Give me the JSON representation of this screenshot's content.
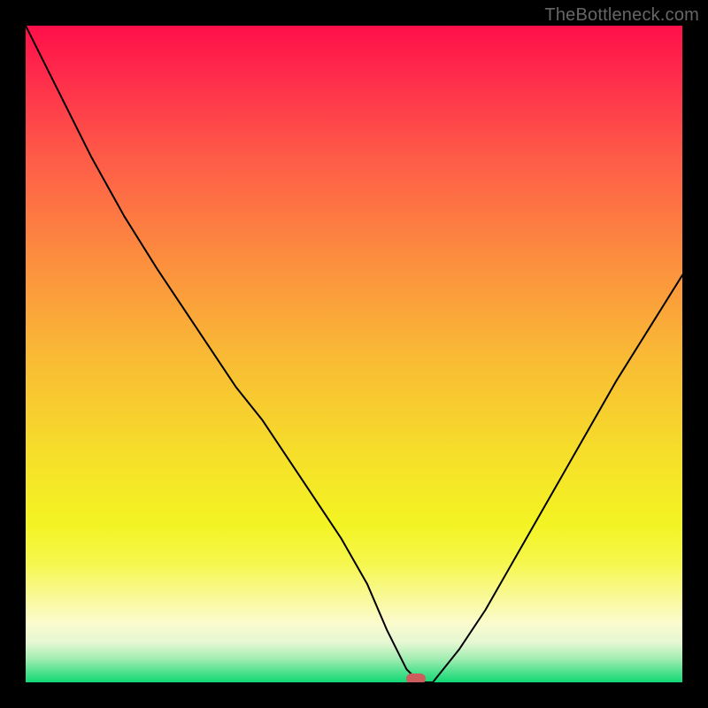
{
  "attribution": "TheBottleneck.com",
  "chart_data": {
    "type": "line",
    "title": "",
    "xlabel": "",
    "ylabel": "",
    "x": [
      0.0,
      0.05,
      0.1,
      0.15,
      0.2,
      0.24,
      0.28,
      0.32,
      0.36,
      0.4,
      0.44,
      0.48,
      0.52,
      0.55,
      0.58,
      0.6,
      0.62,
      0.66,
      0.7,
      0.74,
      0.78,
      0.82,
      0.86,
      0.9,
      0.95,
      1.0
    ],
    "values": [
      1.0,
      0.9,
      0.8,
      0.71,
      0.63,
      0.57,
      0.51,
      0.45,
      0.4,
      0.34,
      0.28,
      0.22,
      0.15,
      0.08,
      0.02,
      0.0,
      0.0,
      0.05,
      0.11,
      0.18,
      0.25,
      0.32,
      0.39,
      0.46,
      0.54,
      0.62
    ],
    "xlim": [
      0,
      1
    ],
    "ylim": [
      0,
      1
    ],
    "marker": {
      "x": 0.595,
      "y": 0.0
    },
    "gradient_stops": [
      {
        "offset": 0.0,
        "color": "#FF0F4A"
      },
      {
        "offset": 0.08,
        "color": "#FF2D4B"
      },
      {
        "offset": 0.2,
        "color": "#FE5B48"
      },
      {
        "offset": 0.35,
        "color": "#FC8C3F"
      },
      {
        "offset": 0.5,
        "color": "#F9B935"
      },
      {
        "offset": 0.65,
        "color": "#F6DE2A"
      },
      {
        "offset": 0.76,
        "color": "#F3F423"
      },
      {
        "offset": 0.82,
        "color": "#F6F74F"
      },
      {
        "offset": 0.87,
        "color": "#F9F998"
      },
      {
        "offset": 0.91,
        "color": "#FBFBCE"
      },
      {
        "offset": 0.94,
        "color": "#E4F7D2"
      },
      {
        "offset": 0.965,
        "color": "#9FEDB0"
      },
      {
        "offset": 0.985,
        "color": "#4BE08C"
      },
      {
        "offset": 1.0,
        "color": "#12D876"
      }
    ]
  }
}
